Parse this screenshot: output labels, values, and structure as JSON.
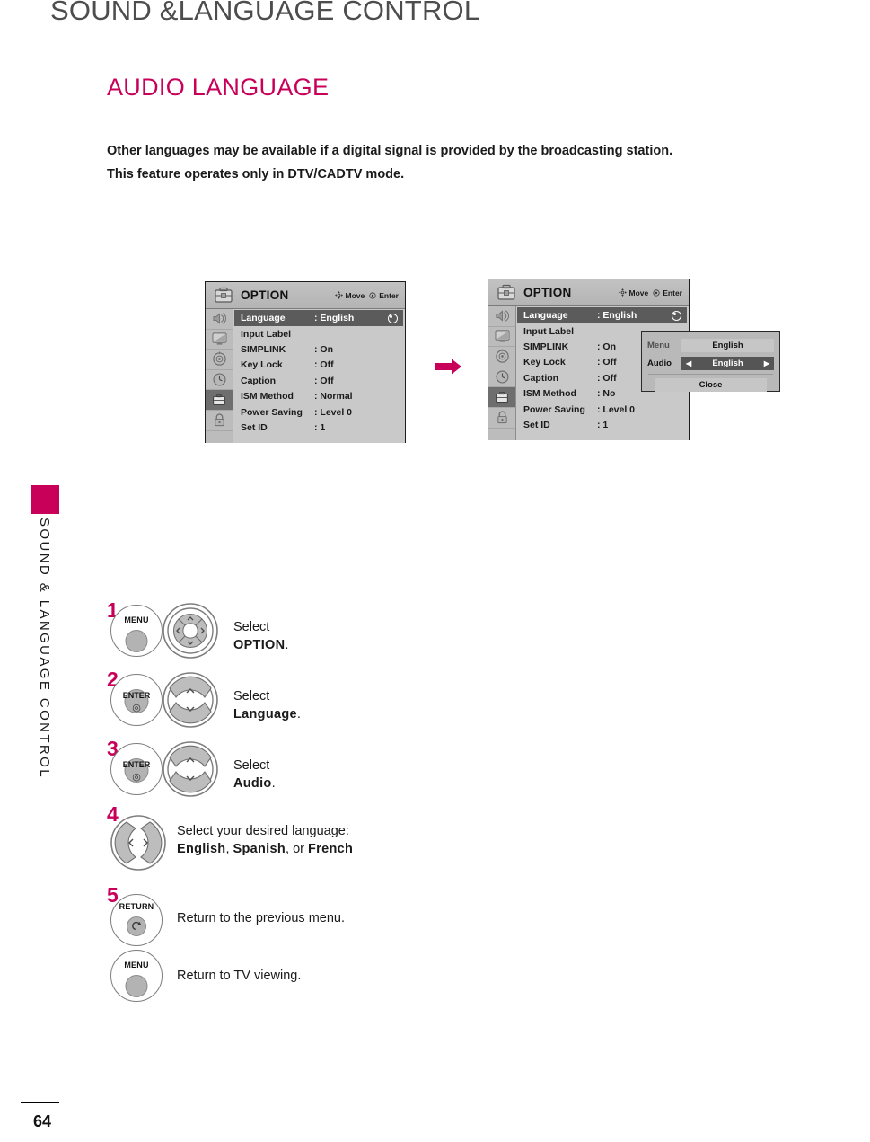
{
  "page": {
    "header": "SOUND &LANGUAGE CONTROL",
    "section_title": "AUDIO LANGUAGE",
    "intro_line1": "Other languages may be available if a digital signal is provided by the broadcasting station.",
    "intro_line2": "This feature operates only in DTV/CADTV mode.",
    "side_tab": "SOUND & LANGUAGE CONTROL",
    "page_number": "64",
    "accent_color": "#c8005a",
    "header_color": "#4d4d4d"
  },
  "osd_menu_1": {
    "title": "OPTION",
    "hints": [
      {
        "icon": "dpad-icon",
        "label": "Move"
      },
      {
        "icon": "enter-ring-icon",
        "label": "Enter"
      }
    ],
    "rail_icons": [
      "audio-icon",
      "picture-tv-icon",
      "setup-target-icon",
      "time-clock-icon",
      "option-briefcase-icon",
      "lock-icon"
    ],
    "rows": [
      {
        "label": "Language",
        "value": ": English",
        "selected": true,
        "bullet": true
      },
      {
        "label": "Input Label",
        "value": "",
        "selected": false,
        "bullet": false
      },
      {
        "label": "SIMPLINK",
        "value": ": On",
        "selected": false,
        "bullet": false
      },
      {
        "label": "Key Lock",
        "value": ": Off",
        "selected": false,
        "bullet": false
      },
      {
        "label": "Caption",
        "value": ": Off",
        "selected": false,
        "bullet": false
      },
      {
        "label": "ISM Method",
        "value": ": Normal",
        "selected": false,
        "bullet": false
      },
      {
        "label": "Power Saving",
        "value": ": Level 0",
        "selected": false,
        "bullet": false
      },
      {
        "label": "Set ID",
        "value": ": 1",
        "selected": false,
        "bullet": false
      }
    ]
  },
  "osd_menu_2": {
    "title": "OPTION",
    "hints": [
      {
        "icon": "dpad-icon",
        "label": "Move"
      },
      {
        "icon": "enter-ring-icon",
        "label": "Enter"
      }
    ],
    "rows": [
      {
        "label": "Language",
        "value": ": English",
        "selected": true,
        "bullet": true
      },
      {
        "label": "Input Label",
        "value": "",
        "selected": false,
        "bullet": false
      },
      {
        "label": "SIMPLINK",
        "value": ": On",
        "selected": false,
        "bullet": false
      },
      {
        "label": "Key Lock",
        "value": ": Off",
        "selected": false,
        "bullet": false
      },
      {
        "label": "Caption",
        "value": ": Off",
        "selected": false,
        "bullet": false
      },
      {
        "label": "ISM Method",
        "value": ": No",
        "selected": false,
        "bullet": false
      },
      {
        "label": "Power Saving",
        "value": ": Level 0",
        "selected": false,
        "bullet": false
      },
      {
        "label": "Set ID",
        "value": ": 1",
        "selected": false,
        "bullet": false
      }
    ],
    "popup": {
      "menu_key": "Menu",
      "menu_value": "English",
      "audio_key": "Audio",
      "audio_value": "English",
      "left_arrow": "◀",
      "right_arrow": "▶",
      "close_label": "Close"
    }
  },
  "steps": [
    {
      "num": "1",
      "button": {
        "type": "menu",
        "label": "MENU"
      },
      "pad": "dpad-4way",
      "text_pre": "Select ",
      "text_key": "OPTION",
      "text_post": "."
    },
    {
      "num": "2",
      "button": {
        "type": "enter",
        "label": "ENTER"
      },
      "pad": "dpad-updown",
      "text_pre": "Select ",
      "text_key": "Language",
      "text_post": "."
    },
    {
      "num": "3",
      "button": {
        "type": "enter",
        "label": "ENTER"
      },
      "pad": "dpad-updown",
      "text_pre": "Select ",
      "text_key": "Audio",
      "text_post": "."
    },
    {
      "num": "4",
      "button": {
        "type": "leftright",
        "label": ""
      },
      "pad": "dpad-leftright",
      "text_line1": "Select  your  desired  language:",
      "text_opt1": "English",
      "text_sep1": ", ",
      "text_opt2": "Spanish",
      "text_sep2": ", or ",
      "text_opt3": "French"
    },
    {
      "num": "5",
      "button": {
        "type": "return",
        "label": "RETURN"
      },
      "text": "Return to the previous menu."
    },
    {
      "num": "",
      "button": {
        "type": "menu",
        "label": "MENU"
      },
      "text": "Return to TV viewing."
    }
  ]
}
